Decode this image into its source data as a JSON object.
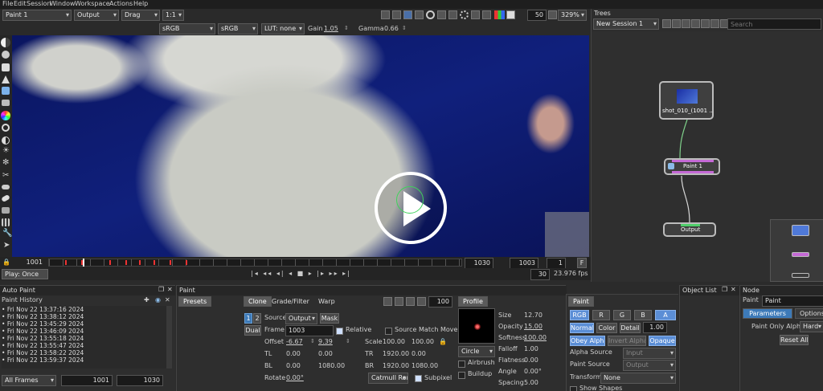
{
  "menu": [
    "File",
    "Edit",
    "Session",
    "Window",
    "Workspace",
    "Actions",
    "Help"
  ],
  "toolbar": {
    "view": "Paint 1",
    "output": "Output",
    "mode": "Drag",
    "ratio": "1:1",
    "frame_field": "50",
    "zoom": "329%"
  },
  "viewer_bar": {
    "lut1": "sRGB",
    "lut2": "sRGB",
    "lut_label": "LUT: none",
    "gain_label": "Gain",
    "gain_value": "1.05",
    "gamma_label": "Gamma",
    "gamma_value": "0.66"
  },
  "timeline": {
    "start_frame": "1001",
    "end_frame": "1030",
    "current_frame": "1003",
    "step": "1",
    "flag": "F",
    "play_mode": "Play: Once",
    "fps_frames": "30",
    "fps": "23.976 fps"
  },
  "trees": {
    "title": "Trees",
    "session": "New Session 1",
    "search_placeholder": "Search",
    "node_source": "shot_010_(1001 ...",
    "node_paint": "Paint 1",
    "node_output": "Output"
  },
  "auto_paint": {
    "title": "Auto Paint",
    "history_title": "Paint History",
    "items": [
      "Fri Nov 22 13:37:16 2024",
      "Fri Nov 22 13:38:12 2024",
      "Fri Nov 22 13:45:29 2024",
      "Fri Nov 22 13:46:09 2024",
      "Fri Nov 22 13:55:18 2024",
      "Fri Nov 22 13:55:47 2024",
      "Fri Nov 22 13:58:22 2024",
      "Fri Nov 22 13:59:37 2024"
    ],
    "frames_dropdown": "All Frames",
    "range_start": "1001",
    "range_end": "1030"
  },
  "paint": {
    "title": "Paint",
    "presets_tab": "Presets",
    "tabs": [
      "Clone",
      "Grade/Filter",
      "Warp"
    ],
    "opacity_field": "100",
    "profile_tab": "Profile",
    "slot1": "1",
    "slot2": "2",
    "dual": "Dual",
    "source_label": "Source",
    "source_value": "Output",
    "mask_btn": "Mask",
    "frame_label": "Frame",
    "frame_value": "1003",
    "relative_label": "Relative",
    "source_match_label": "Source Match Move",
    "offset_label": "Offset",
    "offset_x": "-6.67",
    "offset_y": "9.39",
    "scale_label": "Scale",
    "scale_x": "100.00",
    "scale_y": "100.00",
    "tl_label": "TL",
    "tl_x": "0.00",
    "tl_y": "0.00",
    "tr_label": "TR",
    "tr_x": "1920.00",
    "tr_y": "0.00",
    "bl_label": "BL",
    "bl_x": "0.00",
    "bl_y": "1080.00",
    "br_label": "BR",
    "br_x": "1920.00",
    "br_y": "1080.00",
    "rotate_label": "Rotate",
    "rotate_value": "0.00°",
    "filter_dd": "Catmull Rom",
    "subpixel_label": "Subpixel"
  },
  "brush": {
    "shape": "Circle",
    "airbrush": "Airbrush",
    "buildup": "Buildup",
    "size_label": "Size",
    "size_value": "12.70",
    "opacity_label": "Opacity",
    "opacity_value": "15.00",
    "softness_label": "Softness",
    "softness_value": "100.00",
    "falloff_label": "Falloff",
    "falloff_value": "1.00",
    "flatness_label": "Flatness",
    "flatness_value": "0.00",
    "angle_label": "Angle",
    "angle_value": "0.00°",
    "spacing_label": "Spacing",
    "spacing_value": "5.00"
  },
  "paint_node": {
    "title": "Paint",
    "channels": [
      "RGB",
      "R",
      "G",
      "B",
      "A"
    ],
    "normal": "Normal",
    "color": "Color",
    "detail": "Detail",
    "detail_value": "1.00",
    "obey_alpha": "Obey Alpha",
    "invert_alpha": "Invert Alpha",
    "opaque": "Opaque",
    "alpha_source_label": "Alpha Source",
    "alpha_source_value": "Input",
    "paint_source_label": "Paint Source",
    "paint_source_value": "Output",
    "transform_label": "Transform",
    "transform_value": "None",
    "show_shapes": "Show Shapes"
  },
  "object_list": {
    "title": "Object List"
  },
  "node_panel": {
    "title": "Node",
    "type_label": "Paint",
    "name_value": "Paint",
    "tab_parameters": "Parameters",
    "tab_options": "Options",
    "paint_only_alpha_label": "Paint Only Alpha",
    "paint_only_alpha_value": "Hard",
    "reset_all": "Reset All"
  },
  "colors": {
    "accent": "#3d7ab8",
    "viewer_bg": "#0c1a6e",
    "panel_bg": "#2e2e2e",
    "node_purple": "#c56ad6",
    "node_green": "#4fcf6a"
  }
}
